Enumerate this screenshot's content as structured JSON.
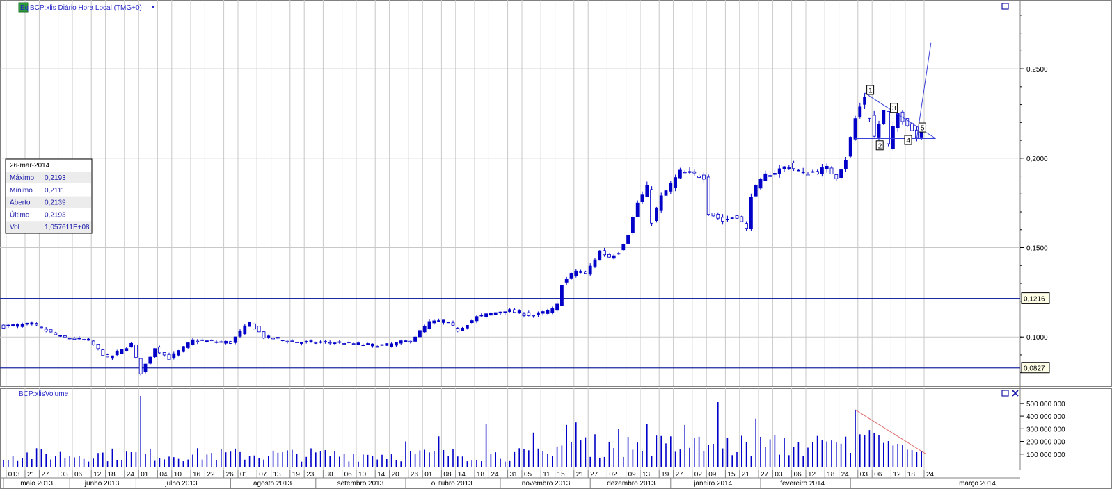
{
  "price_title": "BCP:xlis Diário Hora Local (TMG+0)",
  "price_badge": "Eq",
  "volume_title": "BCP:xlisVolume",
  "info_panel": {
    "date": "26-mar-2014",
    "rows": [
      {
        "label": "Máximo",
        "value": "0,2193"
      },
      {
        "label": "Mínimo",
        "value": "0,2111"
      },
      {
        "label": "Aberto",
        "value": "0,2139"
      },
      {
        "label": "Último",
        "value": "0,2193"
      },
      {
        "label": "Vol",
        "value": "1,057611E+08"
      }
    ]
  },
  "colors": {
    "series": "#0000c8",
    "grid": "#c8c8c8",
    "title": "#2626c8",
    "trend_volume": "#e07070",
    "level": "#1f2aa0"
  },
  "chart_data": [
    {
      "type": "candlestick",
      "title": "BCP:xlis Diário Hora Local (TMG+0)",
      "ylim": [
        0.0725,
        0.2885
      ],
      "y_ticks": [
        {
          "value": 0.1,
          "label": "0,1000"
        },
        {
          "value": 0.15,
          "label": "0,1500"
        },
        {
          "value": 0.2,
          "label": "0,2000"
        },
        {
          "value": 0.25,
          "label": "0,2500"
        }
      ],
      "levels": [
        {
          "value": 0.1216,
          "label": "0,1216"
        },
        {
          "value": 0.0827,
          "label": "0,0827"
        }
      ],
      "waypoints": [
        {
          "idx": 0,
          "v": 0.106
        },
        {
          "idx": 6,
          "v": 0.107
        },
        {
          "idx": 12,
          "v": 0.1
        },
        {
          "idx": 18,
          "v": 0.098
        },
        {
          "idx": 22,
          "v": 0.088
        },
        {
          "idx": 27,
          "v": 0.096
        },
        {
          "idx": 29,
          "v": 0.08
        },
        {
          "idx": 32,
          "v": 0.094
        },
        {
          "idx": 35,
          "v": 0.088
        },
        {
          "idx": 40,
          "v": 0.098
        },
        {
          "idx": 48,
          "v": 0.097
        },
        {
          "idx": 52,
          "v": 0.108
        },
        {
          "idx": 55,
          "v": 0.1
        },
        {
          "idx": 62,
          "v": 0.097
        },
        {
          "idx": 70,
          "v": 0.097
        },
        {
          "idx": 80,
          "v": 0.095
        },
        {
          "idx": 86,
          "v": 0.098
        },
        {
          "idx": 90,
          "v": 0.108
        },
        {
          "idx": 93,
          "v": 0.109
        },
        {
          "idx": 96,
          "v": 0.104
        },
        {
          "idx": 100,
          "v": 0.111
        },
        {
          "idx": 106,
          "v": 0.115
        },
        {
          "idx": 112,
          "v": 0.112
        },
        {
          "idx": 116,
          "v": 0.115
        },
        {
          "idx": 117,
          "v": 0.118
        },
        {
          "idx": 118,
          "v": 0.13
        },
        {
          "idx": 121,
          "v": 0.137
        },
        {
          "idx": 123,
          "v": 0.135
        },
        {
          "idx": 126,
          "v": 0.148
        },
        {
          "idx": 128,
          "v": 0.145
        },
        {
          "idx": 130,
          "v": 0.148
        },
        {
          "idx": 132,
          "v": 0.158
        },
        {
          "idx": 134,
          "v": 0.175
        },
        {
          "idx": 136,
          "v": 0.183
        },
        {
          "idx": 137,
          "v": 0.165
        },
        {
          "idx": 139,
          "v": 0.178
        },
        {
          "idx": 141,
          "v": 0.185
        },
        {
          "idx": 143,
          "v": 0.192
        },
        {
          "idx": 148,
          "v": 0.19
        },
        {
          "idx": 149,
          "v": 0.17
        },
        {
          "idx": 152,
          "v": 0.165
        },
        {
          "idx": 155,
          "v": 0.168
        },
        {
          "idx": 157,
          "v": 0.16
        },
        {
          "idx": 158,
          "v": 0.18
        },
        {
          "idx": 161,
          "v": 0.19
        },
        {
          "idx": 166,
          "v": 0.196
        },
        {
          "idx": 169,
          "v": 0.191
        },
        {
          "idx": 174,
          "v": 0.194
        },
        {
          "idx": 176,
          "v": 0.19
        },
        {
          "idx": 178,
          "v": 0.2
        },
        {
          "idx": 180,
          "v": 0.222
        },
        {
          "idx": 182,
          "v": 0.235
        },
        {
          "idx": 184,
          "v": 0.212
        },
        {
          "idx": 186,
          "v": 0.226
        },
        {
          "idx": 187,
          "v": 0.207
        },
        {
          "idx": 189,
          "v": 0.225
        },
        {
          "idx": 191,
          "v": 0.22
        },
        {
          "idx": 193,
          "v": 0.212
        },
        {
          "idx": 194,
          "v": 0.2193
        }
      ],
      "annotations": [
        {
          "label": "1",
          "idx": 182,
          "value": 0.238
        },
        {
          "label": "2",
          "idx": 184,
          "value": 0.207
        },
        {
          "label": "3",
          "idx": 187,
          "value": 0.228
        },
        {
          "label": "4",
          "idx": 190,
          "value": 0.21
        },
        {
          "label": "5",
          "idx": 193,
          "value": 0.217
        }
      ],
      "trendlines": [
        {
          "from": {
            "idx": 180,
            "v": 0.211
          },
          "to": {
            "idx": 197,
            "v": 0.211
          }
        },
        {
          "from": {
            "idx": 182,
            "v": 0.2365
          },
          "to": {
            "idx": 197,
            "v": 0.211
          }
        },
        {
          "from": {
            "idx": 193,
            "v": 0.211
          },
          "to": {
            "idx": 196,
            "v": 0.2645
          }
        }
      ]
    },
    {
      "type": "bar",
      "title": "BCP:xlisVolume",
      "ylim": [
        0,
        620000000
      ],
      "y_ticks": [
        {
          "value": 100000000,
          "label": "100 000 000"
        },
        {
          "value": 200000000,
          "label": "200 000 000"
        },
        {
          "value": 300000000,
          "label": "300 000 000"
        },
        {
          "value": 400000000,
          "label": "400 000 000"
        },
        {
          "value": 500000000,
          "label": "500 000 000"
        }
      ],
      "spikes": [
        {
          "idx": 29,
          "v": 560000000
        },
        {
          "idx": 151,
          "v": 510000000
        },
        {
          "idx": 159,
          "v": 380000000
        },
        {
          "idx": 180,
          "v": 450000000
        },
        {
          "idx": 102,
          "v": 340000000
        },
        {
          "idx": 121,
          "v": 350000000
        },
        {
          "idx": 119,
          "v": 330000000
        },
        {
          "idx": 136,
          "v": 340000000
        },
        {
          "idx": 112,
          "v": 270000000
        },
        {
          "idx": 85,
          "v": 200000000
        },
        {
          "idx": 92,
          "v": 240000000
        },
        {
          "idx": 130,
          "v": 300000000
        },
        {
          "idx": 144,
          "v": 330000000
        }
      ],
      "trendline": {
        "from": {
          "idx": 180,
          "v": 450000000
        },
        "to": {
          "idx": 195,
          "v": 100000000
        }
      }
    }
  ],
  "x_axis": {
    "day_ticks": [
      "013",
      "21",
      "27",
      "03",
      "06",
      "12",
      "18",
      "24",
      "01",
      "04",
      "10",
      "16",
      "22",
      "26",
      "01",
      "07",
      "13",
      "19",
      "23",
      "30",
      "06",
      "10",
      "14",
      "20",
      "26",
      "01",
      "08",
      "14",
      "18",
      "24",
      "31",
      "05",
      "11",
      "15",
      "21",
      "27",
      "02",
      "09",
      "13",
      "19",
      "27",
      "02",
      "09",
      "15",
      "21",
      "27",
      "03",
      "06",
      "12",
      "18",
      "24",
      "03",
      "06",
      "12",
      "18",
      "24"
    ],
    "months": [
      {
        "label": "maio 2013",
        "start": 0
      },
      {
        "label": "junho 2013",
        "start": 14
      },
      {
        "label": "julho 2013",
        "start": 28
      },
      {
        "label": "agosto 2013",
        "start": 48
      },
      {
        "label": "setembro 2013",
        "start": 66
      },
      {
        "label": "outubro 2013",
        "start": 85
      },
      {
        "label": "novembro 2013",
        "start": 105
      },
      {
        "label": "dezembro 2013",
        "start": 124
      },
      {
        "label": "janeiro 2014",
        "start": 141
      },
      {
        "label": "fevereiro 2014",
        "start": 160
      },
      {
        "label": "março 2014",
        "start": 179
      }
    ]
  }
}
